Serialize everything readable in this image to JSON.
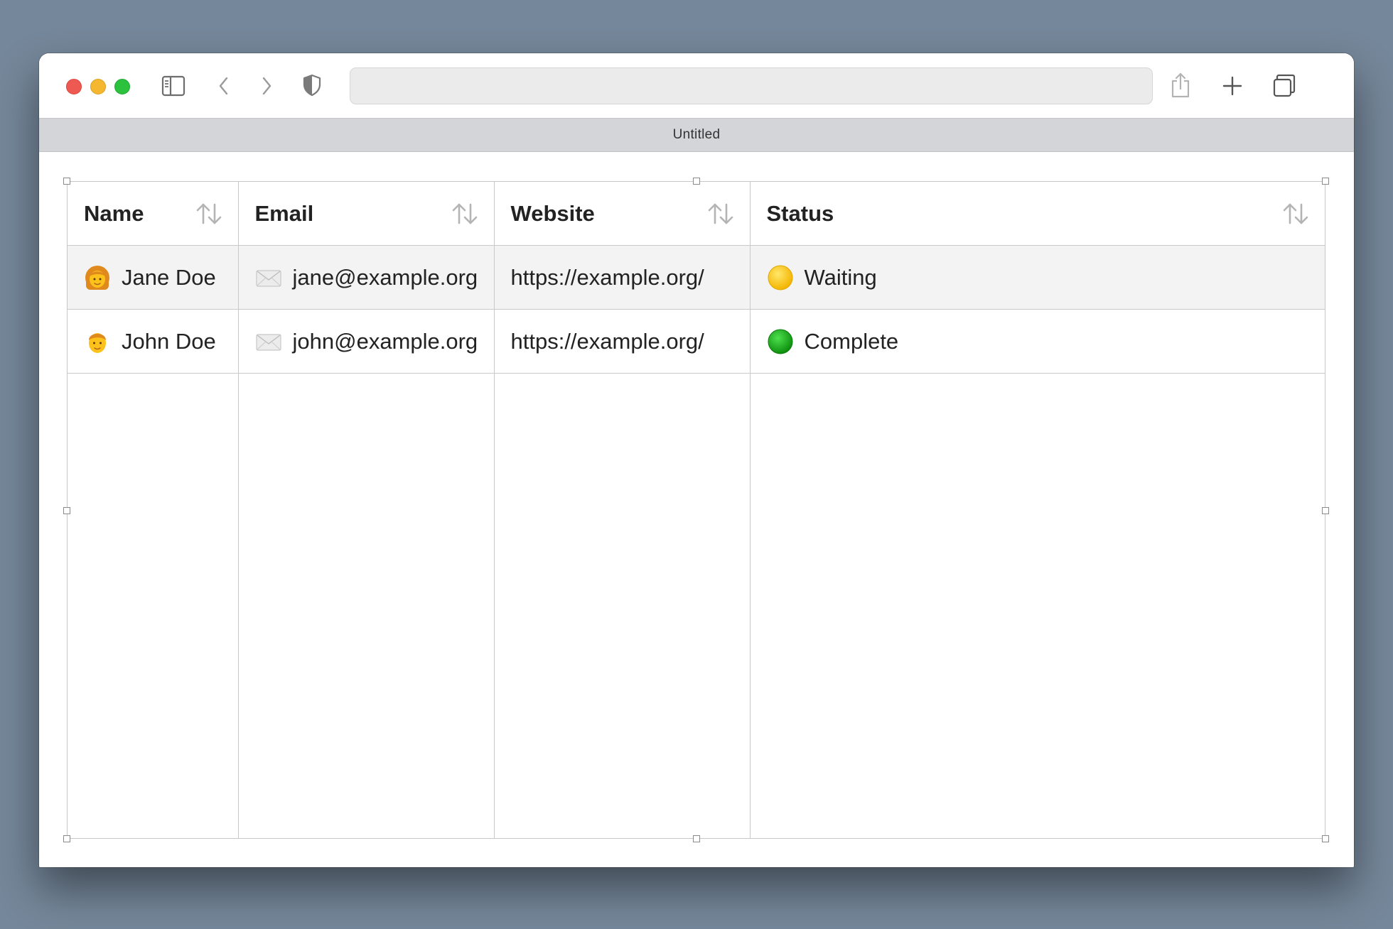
{
  "window": {
    "tab_title": "Untitled",
    "address_value": ""
  },
  "table": {
    "columns": [
      {
        "label": "Name"
      },
      {
        "label": "Email"
      },
      {
        "label": "Website"
      },
      {
        "label": "Status"
      }
    ],
    "rows": [
      {
        "name": "Jane Doe",
        "avatar_icon": "woman-emoji-icon",
        "email": "jane@example.org",
        "email_icon": "envelope-icon",
        "website": "https://example.org/",
        "status": "Waiting",
        "status_icon": "yellow-circle-icon",
        "status_color": "#f8c400"
      },
      {
        "name": "John Doe",
        "avatar_icon": "man-emoji-icon",
        "email": "john@example.org",
        "email_icon": "envelope-icon",
        "website": "https://example.org/",
        "status": "Complete",
        "status_icon": "green-circle-icon",
        "status_color": "#19b019"
      }
    ]
  },
  "colors": {
    "desktop": "#75879a",
    "selected_row": "#f3f3f3",
    "grid_line": "#c9c9c9",
    "sort_icon": "#b4b4b4"
  }
}
